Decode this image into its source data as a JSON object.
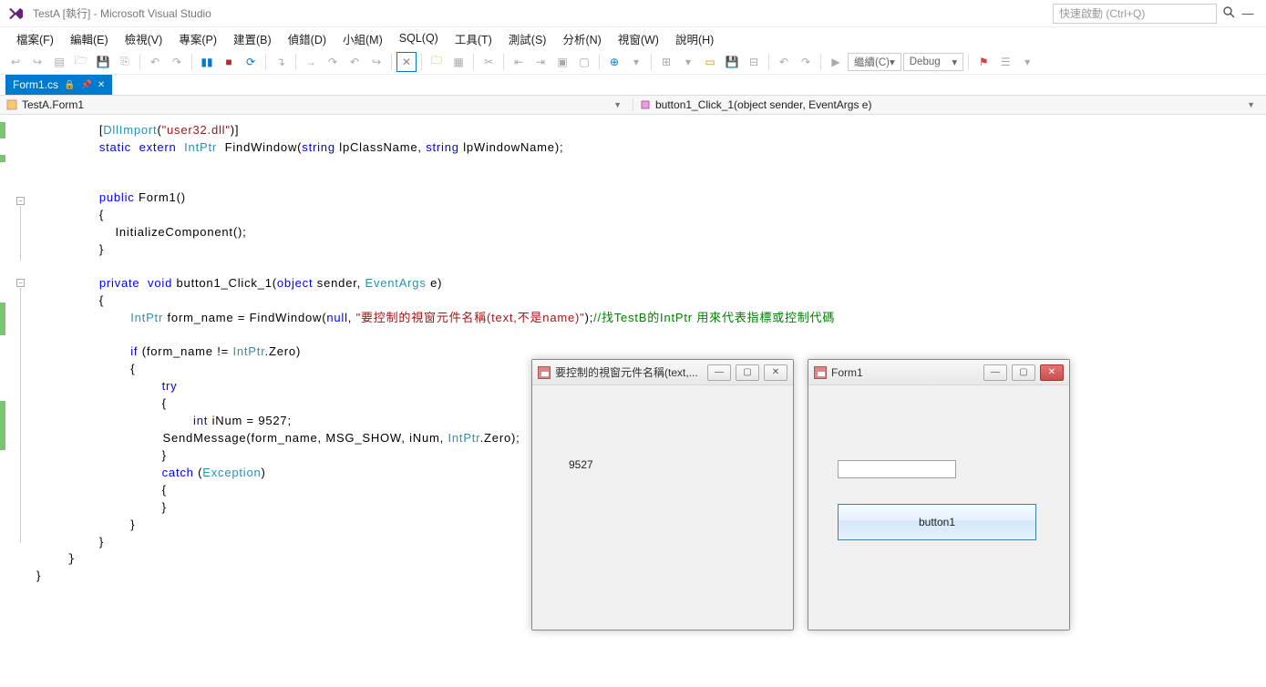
{
  "title": "TestA [執行] - Microsoft Visual Studio",
  "quicklaunch_placeholder": "快速啟動 (Ctrl+Q)",
  "menu": [
    "檔案(F)",
    "編輯(E)",
    "檢視(V)",
    "專案(P)",
    "建置(B)",
    "偵錯(D)",
    "小組(M)",
    "SQL(Q)",
    "工具(T)",
    "測試(S)",
    "分析(N)",
    "視窗(W)",
    "說明(H)"
  ],
  "toolbar": {
    "continue_label": "繼續(C)",
    "config_label": "Debug"
  },
  "tab": {
    "name": "Form1.cs",
    "pinned": true
  },
  "nav": {
    "left": "TestA.Form1",
    "right": "button1_Click_1(object sender, EventArgs e)"
  },
  "code": {
    "l1a": "[",
    "l1b": "DllImport",
    "l1c": "(",
    "l1d": "\"user32.dll\"",
    "l1e": ")]",
    "l2a": "static",
    "l2b": "extern",
    "l2c": "IntPtr",
    "l2d": "FindWindow(",
    "l2e": "string",
    "l2f": " lpClassName, ",
    "l2g": "string",
    "l2h": " lpWindowName);",
    "l3a": "public",
    "l3b": " Form1()",
    "l3c": "{",
    "l4": "    InitializeComponent();",
    "l3d": "}",
    "l5a": "private",
    "l5b": "void",
    "l5c": " button1_Click_1(",
    "l5d": "object",
    "l5e": " sender, ",
    "l5f": "EventArgs",
    "l5g": " e)",
    "l5h": "{",
    "l6a": "IntPtr",
    "l6b": " form_name = FindWindow(",
    "l6c": "null",
    "l6d": ", ",
    "l6e": "\"要控制的視窗元件名稱(text,不是name)\"",
    "l6f": ");",
    "l6g": "//找TestB的IntPtr 用來代表指標或控制代碼",
    "l7a": "if",
    "l7b": " (form_name != ",
    "l7c": "IntPtr",
    "l7d": ".Zero)",
    "l7e": "{",
    "l8": "try",
    "l8b": "{",
    "l9a": "int",
    "l9b": " iNum = 9527;",
    "l10a": "        SendMessage(form_name, MSG_SHOW, iNum, ",
    "l10b": "IntPtr",
    "l10c": ".Zero);",
    "l10d": "}",
    "l11a": "catch",
    "l11b": " (",
    "l11c": "Exception",
    "l11d": ")",
    "l11e": "{",
    "l11f": "}",
    "l12": "}",
    "l13": "}",
    "l14": "}"
  },
  "popup1": {
    "title": "要控制的視窗元件名稱(text,...",
    "label": "9527"
  },
  "popup2": {
    "title": "Form1",
    "input_value": "",
    "button_label": "button1"
  }
}
